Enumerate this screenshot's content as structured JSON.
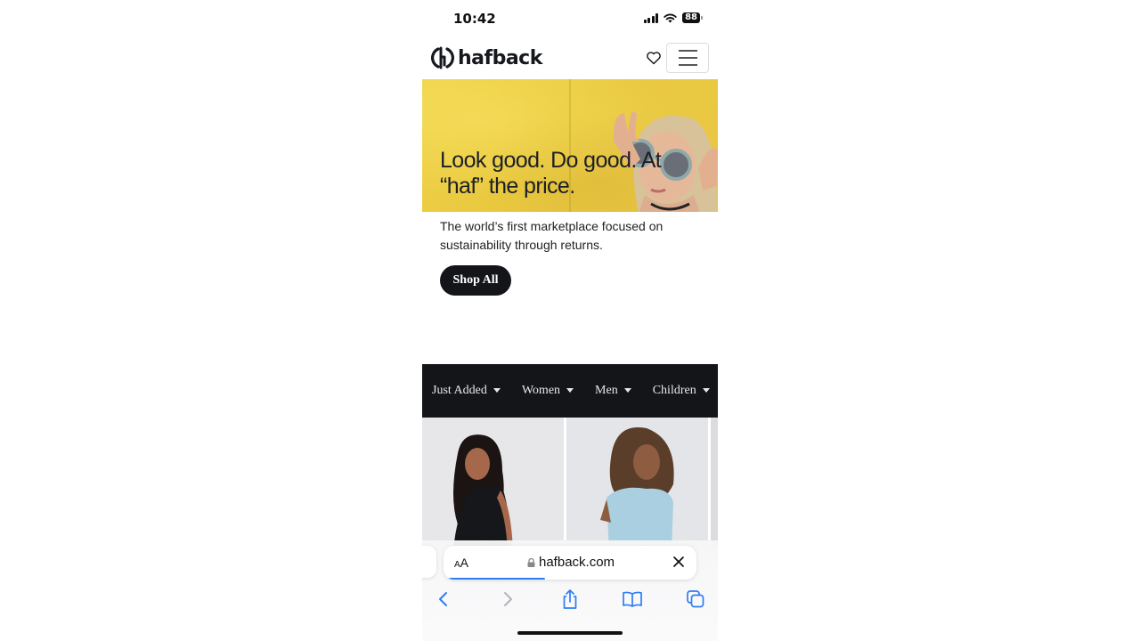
{
  "status_bar": {
    "time": "10:42",
    "battery": "88",
    "icons": [
      "cellular-signal-icon",
      "wifi-icon",
      "battery-icon"
    ]
  },
  "header": {
    "brand": "hafback",
    "icons": [
      "logo-icon",
      "heart-icon",
      "hamburger-menu-icon"
    ]
  },
  "hero": {
    "headline_line1": "Look good. Do good. At",
    "headline_line2": "“haf” the price.",
    "subtext": "The world’s first marketplace focused on sustainability through returns.",
    "cta_label": "Shop All"
  },
  "category_nav": {
    "items": [
      {
        "label": "Just Added"
      },
      {
        "label": "Women"
      },
      {
        "label": "Men"
      },
      {
        "label": "Children"
      }
    ]
  },
  "products": [
    {
      "description": "woman in black sleeveless dress"
    },
    {
      "description": "woman in light blue cap-sleeve top"
    }
  ],
  "browser": {
    "text_size_label": "AA",
    "url": "hafback.com",
    "load_progress_percent": 40,
    "accent_color": "#2f7cf6",
    "toolbar": [
      "back-icon",
      "forward-icon",
      "share-icon",
      "bookmarks-icon",
      "tabs-icon"
    ]
  }
}
